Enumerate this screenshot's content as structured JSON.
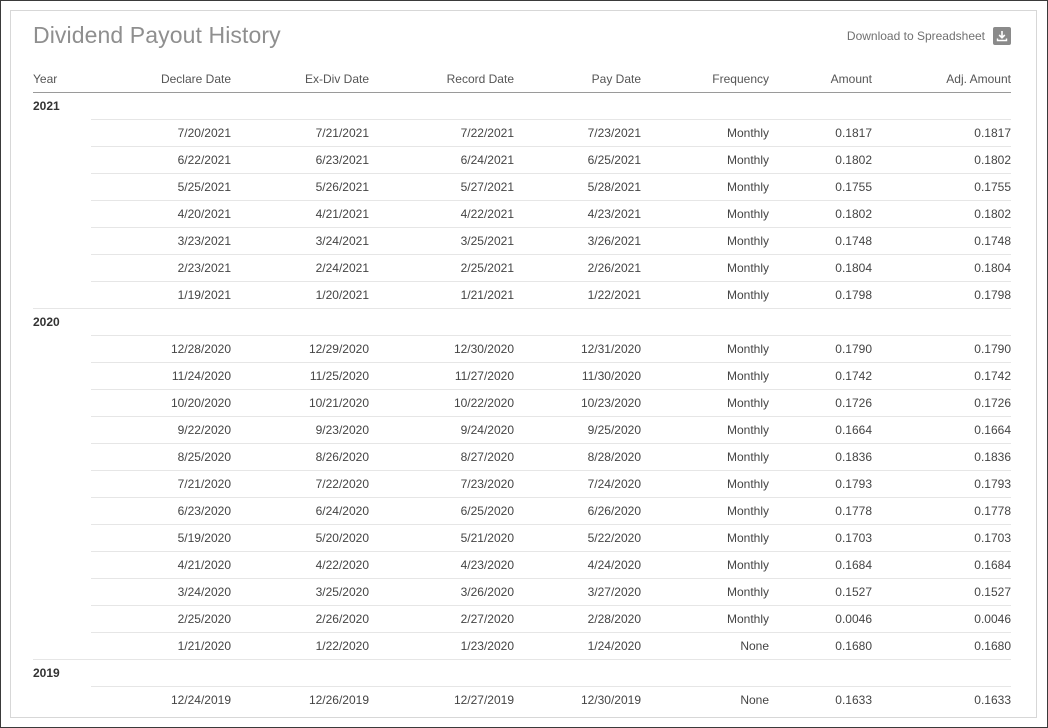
{
  "title": "Dividend Payout History",
  "download_label": "Download to Spreadsheet",
  "download_icon": "download-icon",
  "columns": [
    "Year",
    "Declare Date",
    "Ex-Div Date",
    "Record Date",
    "Pay Date",
    "Frequency",
    "Amount",
    "Adj. Amount"
  ],
  "groups": [
    {
      "year": "2021",
      "rows": [
        [
          "7/20/2021",
          "7/21/2021",
          "7/22/2021",
          "7/23/2021",
          "Monthly",
          "0.1817",
          "0.1817"
        ],
        [
          "6/22/2021",
          "6/23/2021",
          "6/24/2021",
          "6/25/2021",
          "Monthly",
          "0.1802",
          "0.1802"
        ],
        [
          "5/25/2021",
          "5/26/2021",
          "5/27/2021",
          "5/28/2021",
          "Monthly",
          "0.1755",
          "0.1755"
        ],
        [
          "4/20/2021",
          "4/21/2021",
          "4/22/2021",
          "4/23/2021",
          "Monthly",
          "0.1802",
          "0.1802"
        ],
        [
          "3/23/2021",
          "3/24/2021",
          "3/25/2021",
          "3/26/2021",
          "Monthly",
          "0.1748",
          "0.1748"
        ],
        [
          "2/23/2021",
          "2/24/2021",
          "2/25/2021",
          "2/26/2021",
          "Monthly",
          "0.1804",
          "0.1804"
        ],
        [
          "1/19/2021",
          "1/20/2021",
          "1/21/2021",
          "1/22/2021",
          "Monthly",
          "0.1798",
          "0.1798"
        ]
      ]
    },
    {
      "year": "2020",
      "rows": [
        [
          "12/28/2020",
          "12/29/2020",
          "12/30/2020",
          "12/31/2020",
          "Monthly",
          "0.1790",
          "0.1790"
        ],
        [
          "11/24/2020",
          "11/25/2020",
          "11/27/2020",
          "11/30/2020",
          "Monthly",
          "0.1742",
          "0.1742"
        ],
        [
          "10/20/2020",
          "10/21/2020",
          "10/22/2020",
          "10/23/2020",
          "Monthly",
          "0.1726",
          "0.1726"
        ],
        [
          "9/22/2020",
          "9/23/2020",
          "9/24/2020",
          "9/25/2020",
          "Monthly",
          "0.1664",
          "0.1664"
        ],
        [
          "8/25/2020",
          "8/26/2020",
          "8/27/2020",
          "8/28/2020",
          "Monthly",
          "0.1836",
          "0.1836"
        ],
        [
          "7/21/2020",
          "7/22/2020",
          "7/23/2020",
          "7/24/2020",
          "Monthly",
          "0.1793",
          "0.1793"
        ],
        [
          "6/23/2020",
          "6/24/2020",
          "6/25/2020",
          "6/26/2020",
          "Monthly",
          "0.1778",
          "0.1778"
        ],
        [
          "5/19/2020",
          "5/20/2020",
          "5/21/2020",
          "5/22/2020",
          "Monthly",
          "0.1703",
          "0.1703"
        ],
        [
          "4/21/2020",
          "4/22/2020",
          "4/23/2020",
          "4/24/2020",
          "Monthly",
          "0.1684",
          "0.1684"
        ],
        [
          "3/24/2020",
          "3/25/2020",
          "3/26/2020",
          "3/27/2020",
          "Monthly",
          "0.1527",
          "0.1527"
        ],
        [
          "2/25/2020",
          "2/26/2020",
          "2/27/2020",
          "2/28/2020",
          "Monthly",
          "0.0046",
          "0.0046"
        ],
        [
          "1/21/2020",
          "1/22/2020",
          "1/23/2020",
          "1/24/2020",
          "None",
          "0.1680",
          "0.1680"
        ]
      ]
    },
    {
      "year": "2019",
      "rows": [
        [
          "12/24/2019",
          "12/26/2019",
          "12/27/2019",
          "12/30/2019",
          "None",
          "0.1633",
          "0.1633"
        ]
      ]
    }
  ]
}
